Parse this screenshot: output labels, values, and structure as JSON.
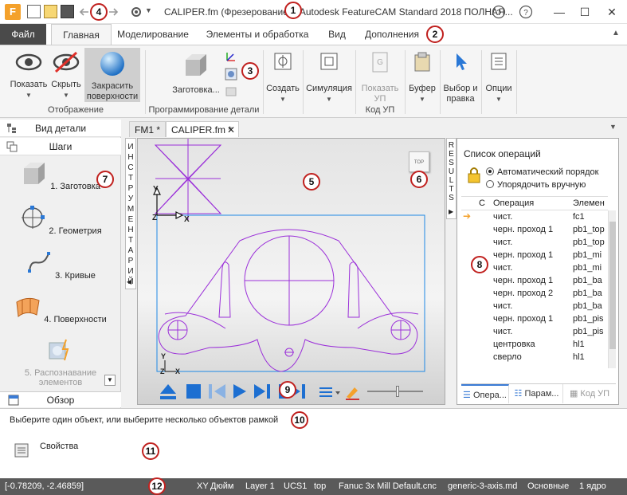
{
  "window": {
    "title": "CALIPER.fm (Фрезерование) - Autodesk FeatureCAM Standard 2018 ПОЛНАЯ...",
    "app_logo": "F",
    "minimize": "—",
    "maximize": "☐",
    "close": "✕"
  },
  "ribbon_tabs": [
    "Файл",
    "Главная",
    "Моделирование",
    "Элементы и обработка",
    "Вид",
    "Дополнения"
  ],
  "ribbon": {
    "show_label": "Показать",
    "hide_label": "Скрыть",
    "shade_label1": "Закрасить",
    "shade_label2": "поверхности",
    "group_display": "Отображение",
    "stock_label": "Заготовка...",
    "group_part": "Программирование детали",
    "create_label": "Создать",
    "simulation_label": "Симуляция",
    "show_nc_label1": "Показать",
    "show_nc_label2": "УП",
    "group_nc": "Код УП",
    "buffer_label": "Буфер",
    "select_label1": "Выбор и",
    "select_label2": "правка",
    "options_label": "Опции"
  },
  "left_panel": {
    "part_view": "Вид детали",
    "steps": "Шаги",
    "items": [
      {
        "label": "1. Заготовка"
      },
      {
        "label": "2. Геометрия"
      },
      {
        "label": "3. Кривые"
      },
      {
        "label": "4. Поверхности"
      },
      {
        "label": "5. Распознавание элементов"
      }
    ],
    "overview": "Обзор"
  },
  "side_tabs": {
    "tools": "ИНСТРУМЕНТАРИЙ",
    "results": "RESULTS"
  },
  "doc_tabs": [
    "FM1 *",
    "CALIPER.fm *"
  ],
  "viewport": {
    "view_cube_label": "TOP",
    "axis_x": "X",
    "axis_y": "Y",
    "axis_z": "Z"
  },
  "operations": {
    "title": "Список операций",
    "radio_auto": "Автоматический порядок",
    "radio_manual": "Упорядочить вручную",
    "headers": [
      "С",
      "Операция",
      "Элемен"
    ],
    "rows": [
      {
        "op": "чист.",
        "el": "fc1"
      },
      {
        "op": "черн. проход 1",
        "el": "pb1_top"
      },
      {
        "op": "чист.",
        "el": "pb1_top"
      },
      {
        "op": "черн. проход 1",
        "el": "pb1_mi"
      },
      {
        "op": "чист.",
        "el": "pb1_mi"
      },
      {
        "op": "черн. проход 1",
        "el": "pb1_ba"
      },
      {
        "op": "черн. проход 2",
        "el": "pb1_ba"
      },
      {
        "op": "чист.",
        "el": "pb1_ba"
      },
      {
        "op": "черн. проход 1",
        "el": "pb1_pis"
      },
      {
        "op": "чист.",
        "el": "pb1_pis"
      },
      {
        "op": "центровка",
        "el": "hl1"
      },
      {
        "op": "сверло",
        "el": "hl1"
      }
    ],
    "tabs": [
      "Опера...",
      "Парам...",
      "Код УП"
    ]
  },
  "prompt": "Выберите один объект, или выберите несколько объектов рамкой",
  "properties_label": "Свойства",
  "status": {
    "coords": "[-0.78209, -2.46859]",
    "plane": "XY",
    "units": "Дюйм",
    "layer": "Layer 1",
    "ucs": "UCS1",
    "view": "top",
    "post": "Fanuc 3x Mill Default.cnc",
    "machine": "generic-3-axis.md",
    "mode": "Основные",
    "cores": "1 ядро"
  },
  "callouts": [
    "1",
    "2",
    "3",
    "4",
    "5",
    "6",
    "7",
    "8",
    "9",
    "10",
    "11",
    "12"
  ],
  "colors": {
    "accent": "#3a7bd5",
    "geometry": "#9b30d9",
    "stock_box": "#1e88e5",
    "callout": "#c0201e"
  }
}
